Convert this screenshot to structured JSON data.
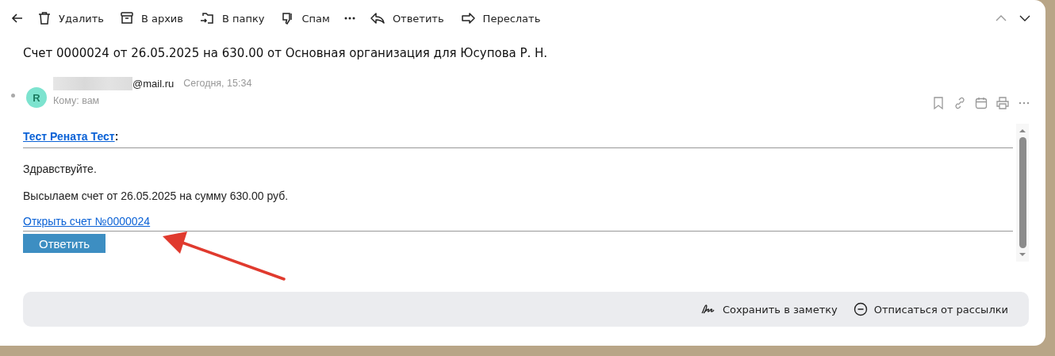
{
  "toolbar": {
    "actions": [
      {
        "label": "Удалить"
      },
      {
        "label": "В архив"
      },
      {
        "label": "В папку"
      },
      {
        "label": "Спам"
      },
      {
        "label": "Ответить"
      },
      {
        "label": "Переслать"
      }
    ]
  },
  "subject": "Счет 0000024 от 26.05.2025 на 630.00 от Основная организация для Юсупова Р. Н.",
  "message": {
    "avatar_letter": "R",
    "sender": "@mail.ru",
    "date": "Сегодня, 15:34",
    "recipient": "Кому: вам"
  },
  "body": {
    "addressee": "Тест Рената Тест",
    "addressee_suffix": ":",
    "paragraphs": [
      "Здравствуйте.",
      "Высылаем счет от 26.05.2025 на сумму 630.00 руб."
    ],
    "link": "Открыть счет №0000024",
    "reply_button": "Ответить"
  },
  "footer_actions": [
    {
      "label": "Сохранить в заметку"
    },
    {
      "label": "Отписаться от рассылки"
    }
  ]
}
